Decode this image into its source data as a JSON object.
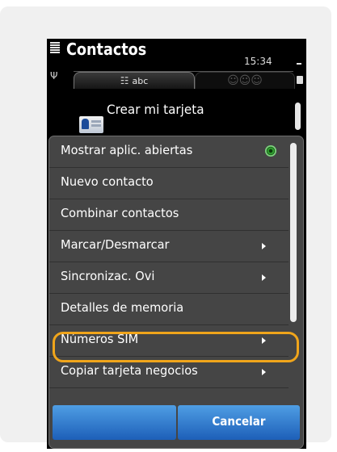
{
  "app": {
    "title": "Contactos",
    "clock": "15:34"
  },
  "tabs": [
    {
      "label": "abc",
      "icon": "contact-list-icon",
      "active": true
    },
    {
      "label": "",
      "icon": "groups-icon",
      "active": false
    }
  ],
  "contacts": {
    "create_card": "Crear mi tarjeta"
  },
  "menu": {
    "items": [
      {
        "label": "Mostrar aplic. abiertas",
        "trailing": "green-dot-icon"
      },
      {
        "label": "Nuevo contacto",
        "trailing": ""
      },
      {
        "label": "Combinar contactos",
        "trailing": ""
      },
      {
        "label": "Marcar/Desmarcar",
        "trailing": "chevron-right-icon"
      },
      {
        "label": "Sincronizac. Ovi",
        "trailing": "chevron-right-icon"
      },
      {
        "label": "Detalles de memoria",
        "trailing": ""
      },
      {
        "label": "Números SIM",
        "trailing": "chevron-right-icon",
        "highlighted": true
      },
      {
        "label": "Copiar tarjeta negocios",
        "trailing": "chevron-right-icon"
      }
    ],
    "cancel_label": "Cancelar"
  },
  "colors": {
    "highlight": "#f0a51b",
    "softkey": "#2b78d0",
    "menu_bg": "#454545",
    "indicator_green": "#2fa02f"
  }
}
